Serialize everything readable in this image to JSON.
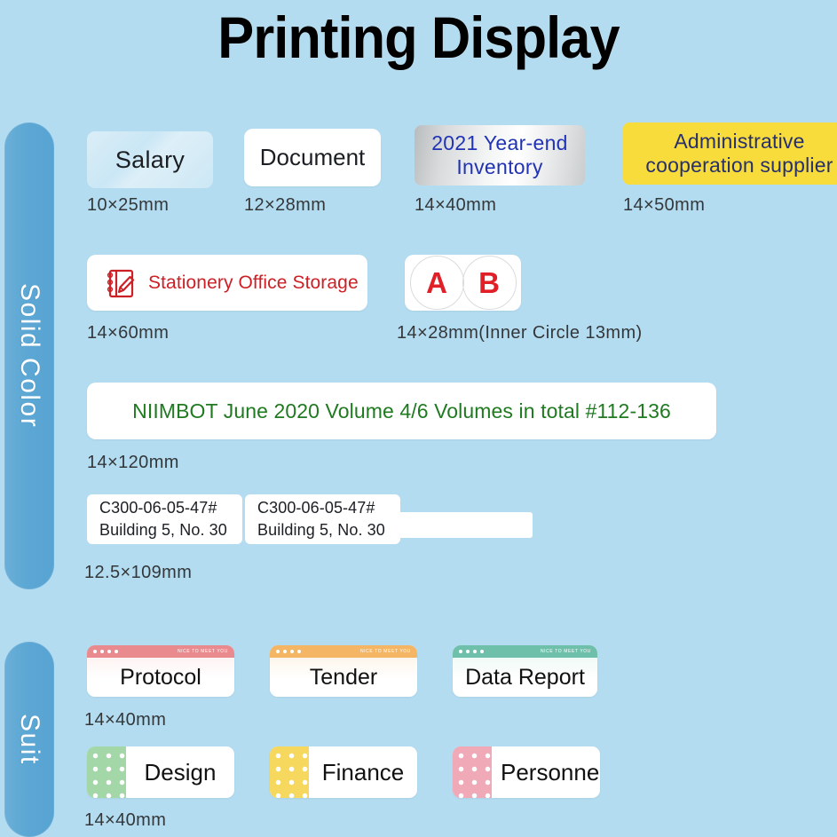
{
  "page": {
    "title": "Printing Display",
    "background_color": "#b4dcf0"
  },
  "sections": [
    {
      "id": "solid-color",
      "tab_label": "Solid Color",
      "tab_color": "#5ca7d4"
    },
    {
      "id": "suit",
      "tab_label": "Suit",
      "tab_color": "#5ca7d4"
    }
  ],
  "solid_color": {
    "row1": [
      {
        "name": "salary",
        "text": "Salary",
        "dimension": "10×25mm",
        "style": "frosted-translucent",
        "text_color": "#1b1f23"
      },
      {
        "name": "document",
        "text": "Document",
        "dimension": "12×28mm",
        "style": "white",
        "text_color": "#1b1f23"
      },
      {
        "name": "inventory",
        "line1": "2021 Year-end",
        "line2": "Inventory",
        "dimension": "14×40mm",
        "style": "silver-metallic",
        "text_color": "#2133b4"
      },
      {
        "name": "administrative",
        "line1": "Administrative",
        "line2": "cooperation supplier",
        "dimension": "14×50mm",
        "style": "yellow",
        "bg_color": "#f8dc3c",
        "text_color": "#27306b"
      }
    ],
    "row2": [
      {
        "name": "stationery",
        "text": "Stationery Office Storage",
        "dimension": "14×60mm",
        "icon": "notebook-pencil-icon",
        "text_color": "#cc2026"
      },
      {
        "name": "ab-circles",
        "circle_a": "A",
        "circle_b": "B",
        "dimension": "14×28mm(Inner Circle  13mm)",
        "text_color": "#e01f26"
      }
    ],
    "row3": [
      {
        "name": "niimbot",
        "text": "NIIMBOT June 2020 Volume 4/6 Volumes in total #112-136",
        "dimension": "14×120mm",
        "text_color": "#1f7a20"
      }
    ],
    "row4": [
      {
        "name": "c300-a",
        "line1": "C300-06-05-47#",
        "line2": "Building 5, No. 30"
      },
      {
        "name": "c300-b",
        "line1": "C300-06-05-47#",
        "line2": "Building 5, No. 30"
      },
      {
        "name": "c300-tail",
        "text": ""
      }
    ],
    "row4_dimension": "12.5×109mm"
  },
  "suit": {
    "row1": [
      {
        "name": "protocol",
        "text": "Protocol",
        "banner": "NICE TO MEET YOU",
        "bar_color": "#e98a8e"
      },
      {
        "name": "tender",
        "text": "Tender",
        "banner": "NICE TO MEET YOU",
        "bar_color": "#f4b564"
      },
      {
        "name": "data-report",
        "text": "Data Report",
        "banner": "NICE TO MEET YOU",
        "bar_color": "#6fc0aa"
      }
    ],
    "row1_dimension": "14×40mm",
    "row2": [
      {
        "name": "design",
        "text": "Design",
        "strip_color": "#a3d7a7"
      },
      {
        "name": "finance",
        "text": "Finance",
        "strip_color": "#f6d85f"
      },
      {
        "name": "personnel",
        "text": "Personnel",
        "strip_color": "#f0a9b7"
      }
    ],
    "row2_dimension": "14×40mm"
  }
}
